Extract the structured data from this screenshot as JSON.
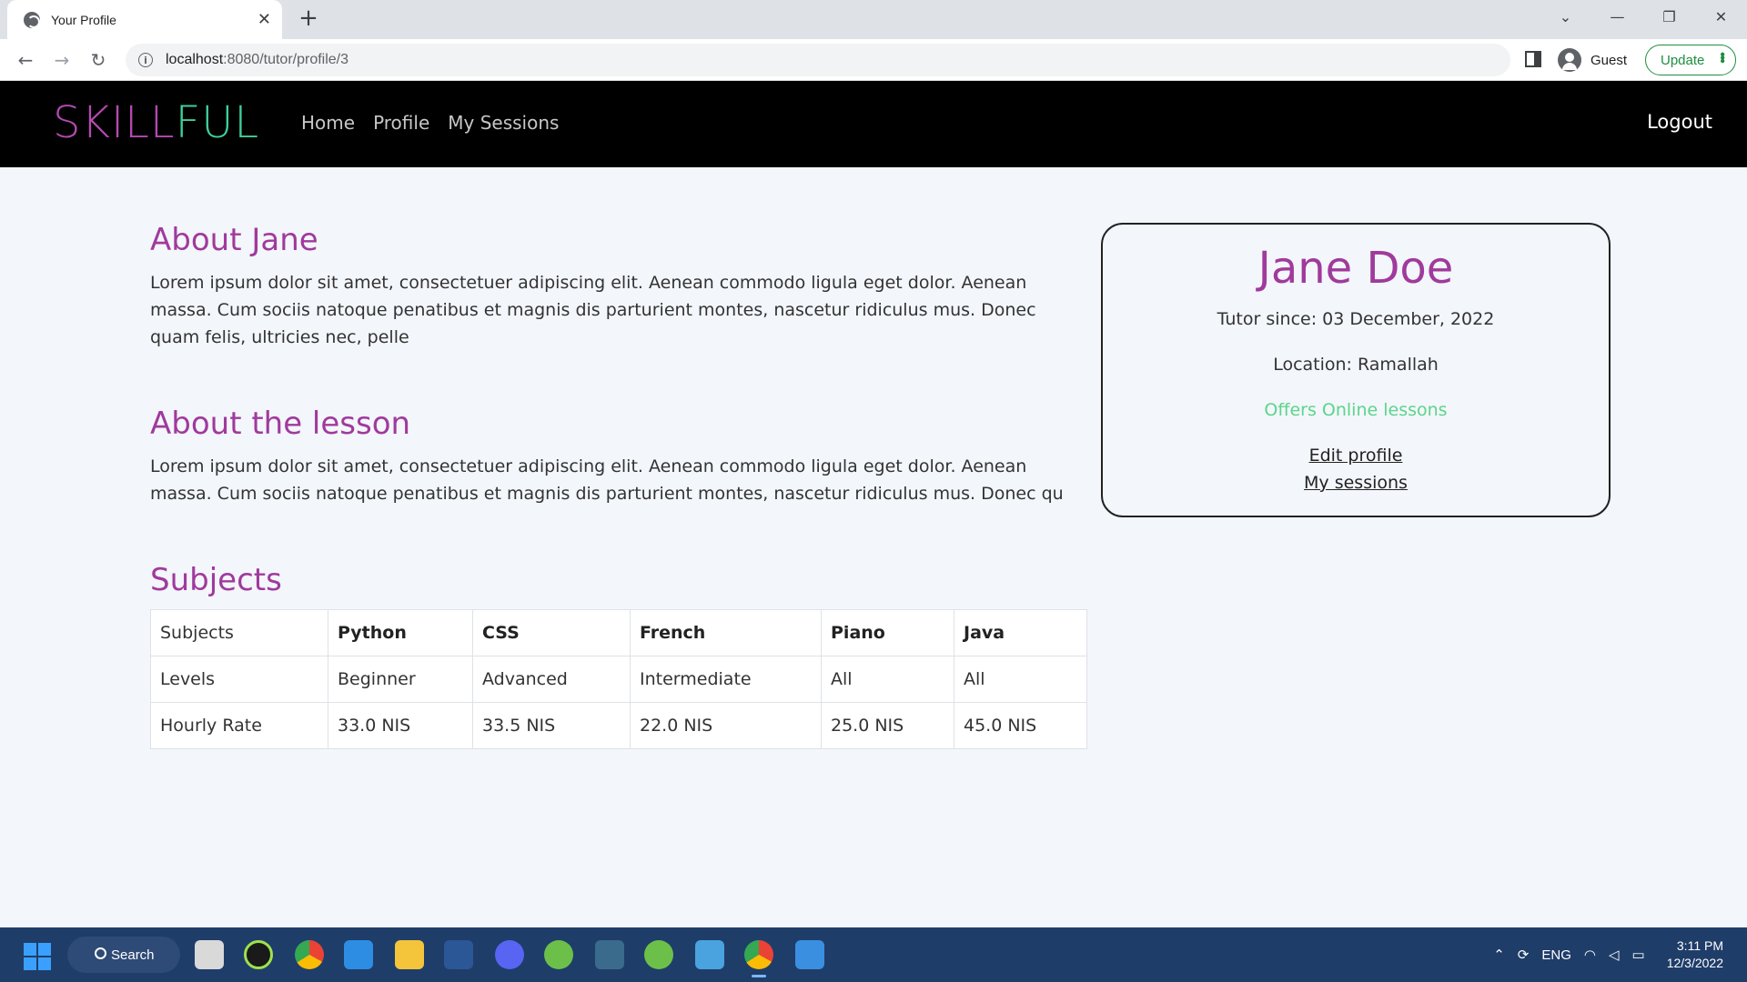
{
  "browser": {
    "tab_title": "Your Profile",
    "url_host": "localhost",
    "url_rest": ":8080/tutor/profile/3",
    "profile_label": "Guest",
    "update_label": "Update"
  },
  "nav": {
    "brand_part1": "SKILL",
    "brand_part2": "FUL",
    "links": [
      "Home",
      "Profile",
      "My Sessions"
    ],
    "logout": "Logout"
  },
  "about": {
    "heading": "About Jane",
    "text": "Lorem ipsum dolor sit amet, consectetuer adipiscing elit. Aenean commodo ligula eget dolor. Aenean massa. Cum sociis natoque penatibus et magnis dis parturient montes, nascetur ridiculus mus. Donec quam felis, ultricies nec, pelle"
  },
  "lesson": {
    "heading": "About the lesson",
    "text": "Lorem ipsum dolor sit amet, consectetuer adipiscing elit. Aenean commodo ligula eget dolor. Aenean massa. Cum sociis natoque penatibus et magnis dis parturient montes, nascetur ridiculus mus. Donec qu"
  },
  "subjects": {
    "heading": "Subjects",
    "rows": [
      [
        "Subjects",
        "Python",
        "CSS",
        "French",
        "Piano",
        "Java"
      ],
      [
        "Levels",
        "Beginner",
        "Advanced",
        "Intermediate",
        "All",
        "All"
      ],
      [
        "Hourly Rate",
        "33.0 NIS",
        "33.5 NIS",
        "22.0 NIS",
        "25.0 NIS",
        "45.0 NIS"
      ]
    ]
  },
  "card": {
    "name": "Jane Doe",
    "tutor_since": "Tutor since: 03 December, 2022",
    "location": "Location: Ramallah",
    "online": "Offers Online lessons",
    "edit_link": "Edit profile",
    "sessions_link": "My sessions"
  },
  "taskbar": {
    "search": "Search",
    "lang": "ENG",
    "time": "3:11 PM",
    "date": "12/3/2022"
  },
  "colors": {
    "brand_purple": "#a03a9c",
    "brand_green": "#3fcf9a",
    "online_green": "#5cd58a"
  }
}
